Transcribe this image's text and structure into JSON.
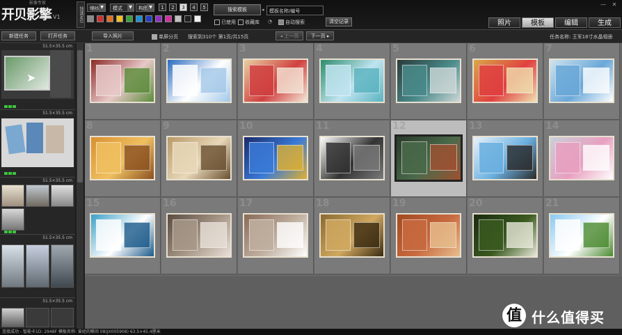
{
  "app": {
    "logo_text": "开贝影擎",
    "version": "V1",
    "subtitle": "影像专家"
  },
  "toolbar": {
    "vertical_tab": "快速定位",
    "dropdown1": "缩纱",
    "dropdown2": "模式",
    "dropdown3": "构图",
    "page_buttons": [
      "1",
      "2",
      "3",
      "4",
      "5"
    ],
    "active_page_button": "3",
    "swatch_colors": [
      "#8a8a8a",
      "#d03030",
      "#e07020",
      "#f0c020",
      "#3aa03a",
      "#2090d0",
      "#2040c0",
      "#9030c0",
      "#d030a0",
      "#c0c0c0",
      "#202020",
      "#f0f0f0"
    ],
    "search_template_label": "搜索模板",
    "search_placeholder": "模板名称/编号",
    "filter_used": "已使用",
    "filter_favorites": "收藏库",
    "auto_search": "自动搜索",
    "clear_record": "清空记录"
  },
  "main_tabs": {
    "photos": "照片",
    "templates": "模板",
    "edit": "编辑",
    "generate": "生成",
    "active": "templates"
  },
  "window_controls": {
    "minimize": "—",
    "close": "✕"
  },
  "toolbar2": {
    "new_task": "新建任务",
    "open_task": "打开任务",
    "import_photos": "导入照片",
    "single_screen_paging": "单屏分页",
    "result_info": "搜索到310个  第1页/共15页",
    "prev_page": "上一页",
    "next_page": "下一页",
    "task_name": "任务名称: 王军18寸水晶相册"
  },
  "left_panel": {
    "items": [
      {
        "size": "51.5×35.5 cm"
      },
      {
        "size": "51.5×35.5 cm"
      },
      {
        "size": "51.5×35.5 cm"
      },
      {
        "size": "51.5×35.5 cm"
      },
      {
        "size": "51.5×35.5 cm"
      }
    ]
  },
  "templates": {
    "numbers": [
      "1",
      "2",
      "3",
      "4",
      "5",
      "6",
      "7",
      "8",
      "9",
      "10",
      "11",
      "12",
      "13",
      "14",
      "15",
      "16",
      "17",
      "18",
      "19",
      "20",
      "21"
    ],
    "selected": "12",
    "palette": [
      [
        "#8c2a2a",
        "#e8c8c8",
        "#5b8c3a"
      ],
      [
        "#2a6cc0",
        "#ffffff",
        "#a3c8e8"
      ],
      [
        "#e8d0a0",
        "#d04040",
        "#f4e8d8"
      ],
      [
        "#2e8c6c",
        "#bfe4f0",
        "#5ab3c0"
      ],
      [
        "#2a3a3a",
        "#4a8a8a",
        "#d0d8d8"
      ],
      [
        "#d8a848",
        "#e04040",
        "#f0e0b0"
      ],
      [
        "#cfe3ef",
        "#6aa8d8",
        "#ffffff"
      ],
      [
        "#d89030",
        "#f0c060",
        "#8a5020"
      ],
      [
        "#b89868",
        "#e8d8b8",
        "#6a5030"
      ],
      [
        "#1a2a6a",
        "#3a7ad8",
        "#e0b030"
      ],
      [
        "#ffffff",
        "#333333",
        "#7a7a7a"
      ],
      [
        "#2a3a2a",
        "#4a6a4a",
        "#a05030"
      ],
      [
        "#eaf2fa",
        "#6ab0e0",
        "#2a2a2a"
      ],
      [
        "#c8d0d8",
        "#e8a0c0",
        "#ffffff"
      ],
      [
        "#3aa0c8",
        "#ffffff",
        "#1a5a8a"
      ],
      [
        "#5a4a40",
        "#a89888",
        "#e8e0d8"
      ],
      [
        "#8a6a58",
        "#c0b0a0",
        "#ffffff"
      ],
      [
        "#8a6a30",
        "#d0a860",
        "#3a2a10"
      ],
      [
        "#a04a20",
        "#c86a40",
        "#e8c090"
      ],
      [
        "#1a2a10",
        "#3a5a20",
        "#e8e8d8"
      ],
      [
        "#8ac8f0",
        "#ffffff",
        "#4a8a30"
      ]
    ]
  },
  "status_bar": "连接成功 - 智能卡1D: 2948F    模板名称: 曾经的瞬间 08(JX005908) 63.5×45.4厘米",
  "watermark": {
    "symbol": "值",
    "text": "什么值得买"
  }
}
